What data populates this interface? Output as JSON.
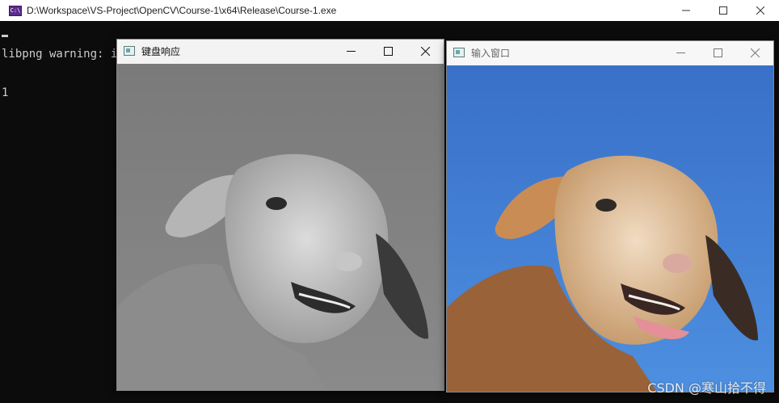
{
  "console": {
    "title": "D:\\Workspace\\VS-Project\\OpenCV\\Course-1\\x64\\Release\\Course-1.exe",
    "icon": "console-app-icon",
    "lines": [
      "libpng warning: iCCP: cHRM chunk does not match sRGB",
      "1"
    ]
  },
  "windows": {
    "keyboard": {
      "title": "键盘响应",
      "image": "grayscale-lamb-photo"
    },
    "input": {
      "title": "输入窗口",
      "image": "color-lamb-photo"
    }
  },
  "controls": {
    "minimize": "minimize-icon",
    "maximize": "maximize-icon",
    "close": "close-icon"
  },
  "colors": {
    "console_bg": "#0c0c0c",
    "console_text": "#cccccc",
    "sky_blue": "#3d7fd4",
    "gray_bg": "#7c7c7c"
  },
  "watermark": "CSDN @寒山拾不得"
}
